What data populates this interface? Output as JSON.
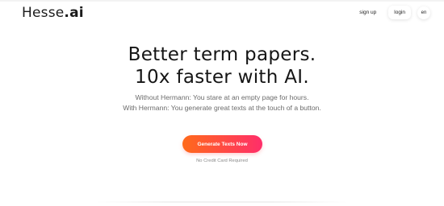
{
  "header": {
    "logo_name": "Hesse",
    "logo_suffix": ".ai",
    "nav": {
      "signup_label": "sign up",
      "login_label": "login",
      "language": "en"
    }
  },
  "hero": {
    "title_line1": "Better term papers.",
    "title_line2": "10x faster with AI.",
    "subtitle_line1": "Without Hermann: You stare at an empty page for hours.",
    "subtitle_line2": "With Hermann: You generate great texts at the touch of a button.",
    "cta_label": "Generate Texts Now",
    "note": "No Credit Card Required"
  },
  "colors": {
    "cta_gradient_start": "#ff6a1a",
    "cta_gradient_end": "#ff2e6a",
    "text_primary": "#151515",
    "text_secondary": "#6b6b6b"
  }
}
